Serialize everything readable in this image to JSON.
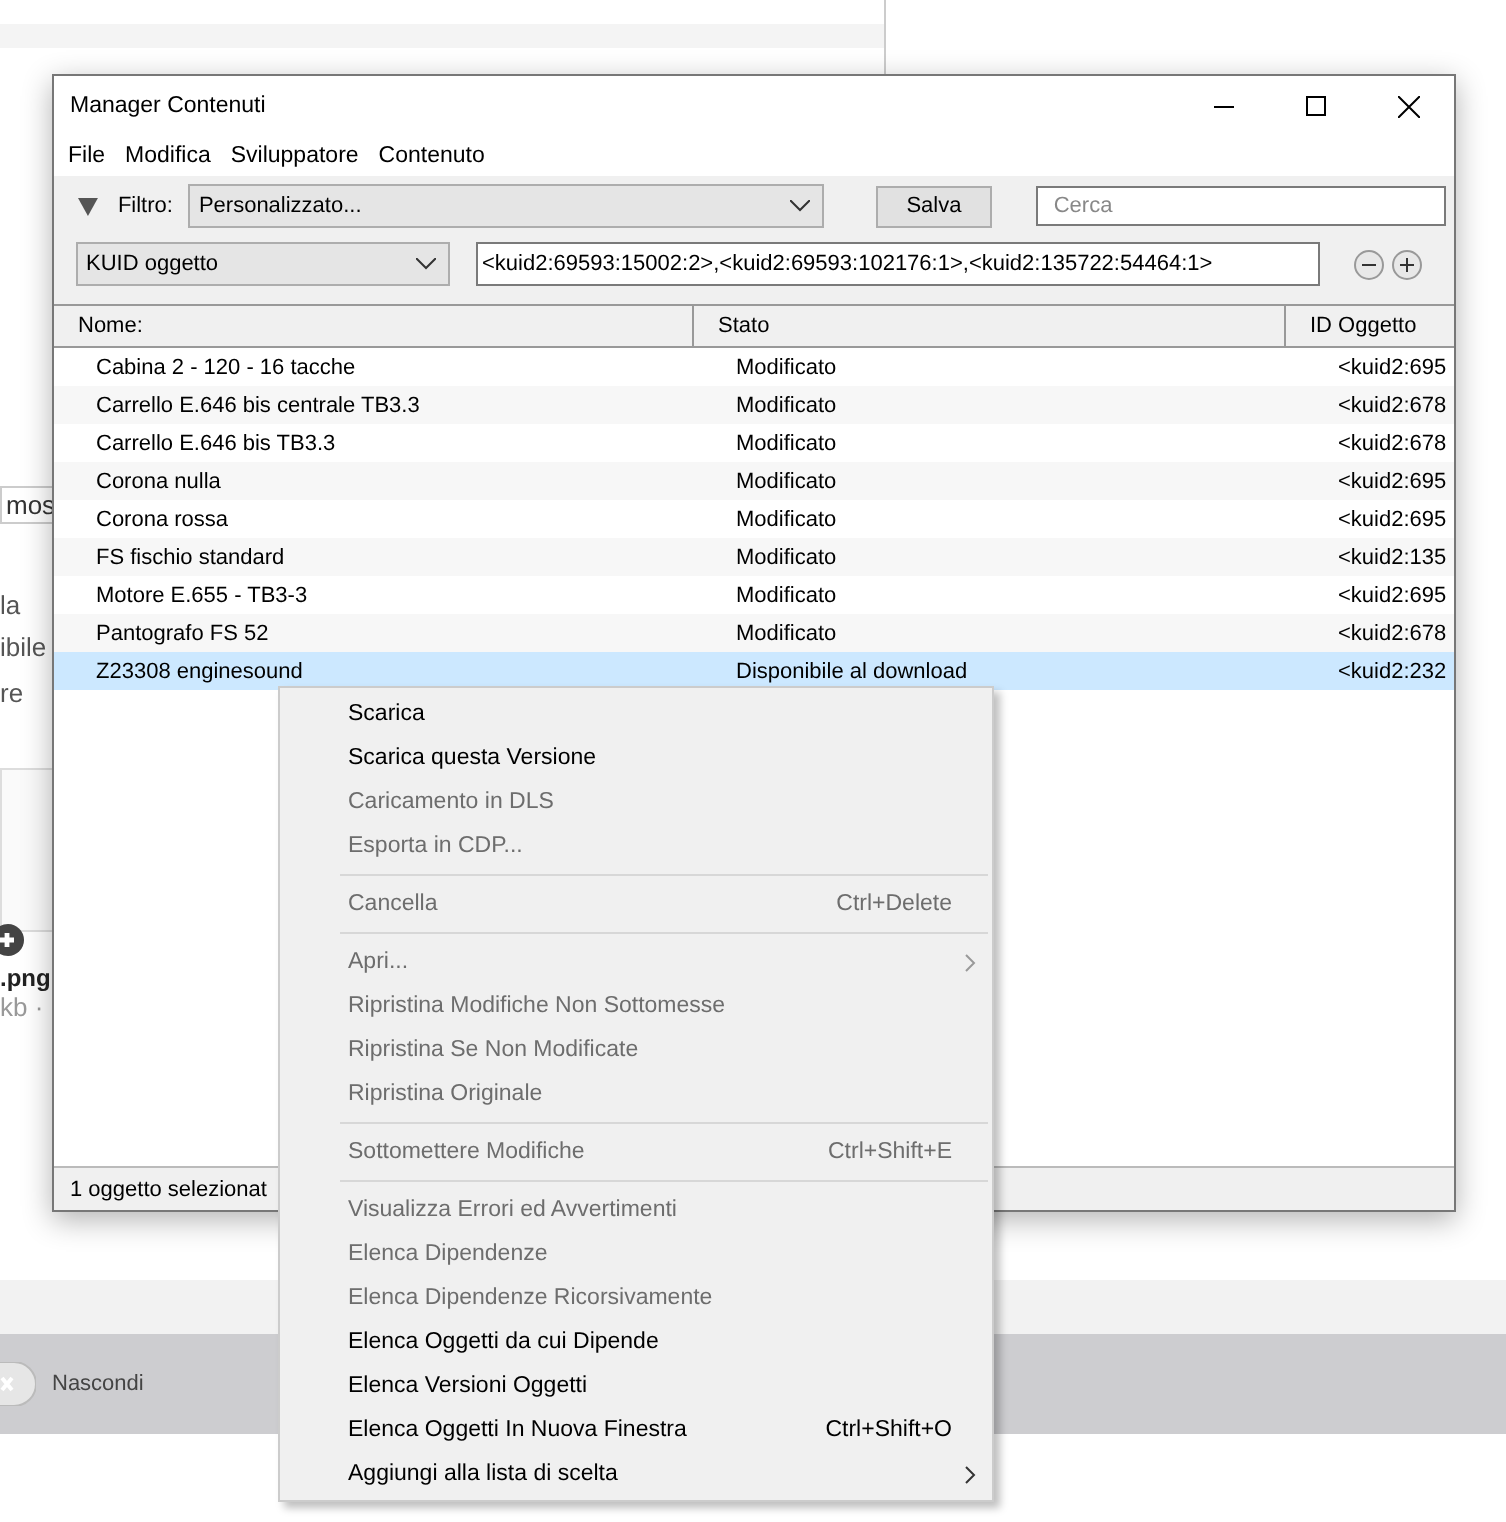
{
  "background": {
    "tab_fragment": "mos",
    "text_lines": [
      "la",
      "ibile"
    ],
    "link_prefix": "re",
    "file_name": ".png",
    "file_size": "kb ·",
    "hide_button": "Nascondi"
  },
  "window": {
    "title": "Manager Contenuti",
    "menu": [
      "File",
      "Modifica",
      "Sviluppatore",
      "Contenuto"
    ],
    "filter": {
      "label": "Filtro:",
      "value": "Personalizzato...",
      "save": "Salva",
      "search_placeholder": "Cerca"
    },
    "kuid": {
      "field": "KUID oggetto",
      "value": "<kuid2:69593:15002:2>,<kuid2:69593:102176:1>,<kuid2:135722:54464:1>"
    },
    "columns": [
      "Nome:",
      "Stato",
      "ID Oggetto"
    ],
    "rows": [
      {
        "name": "Cabina 2 - 120 - 16 tacche",
        "status": "Modificato",
        "id": "<kuid2:695",
        "selected": false
      },
      {
        "name": "Carrello E.646 bis centrale TB3.3",
        "status": "Modificato",
        "id": "<kuid2:678",
        "selected": false
      },
      {
        "name": "Carrello E.646 bis TB3.3",
        "status": "Modificato",
        "id": "<kuid2:678",
        "selected": false
      },
      {
        "name": "Corona nulla",
        "status": "Modificato",
        "id": "<kuid2:695",
        "selected": false
      },
      {
        "name": "Corona rossa",
        "status": "Modificato",
        "id": "<kuid2:695",
        "selected": false
      },
      {
        "name": "FS fischio standard",
        "status": "Modificato",
        "id": "<kuid2:135",
        "selected": false
      },
      {
        "name": "Motore E.655 - TB3-3",
        "status": "Modificato",
        "id": "<kuid2:695",
        "selected": false
      },
      {
        "name": "Pantografo FS 52",
        "status": "Modificato",
        "id": "<kuid2:678",
        "selected": false
      },
      {
        "name": "Z23308 enginesound",
        "status": "Disponibile al download",
        "id": "<kuid2:232",
        "selected": true
      }
    ],
    "status_bar": "1 oggetto selezionat"
  },
  "context_menu": [
    {
      "kind": "item",
      "label": "Scarica",
      "disabled": false
    },
    {
      "kind": "item",
      "label": "Scarica questa Versione",
      "disabled": false
    },
    {
      "kind": "item",
      "label": "Caricamento in DLS",
      "disabled": true
    },
    {
      "kind": "item",
      "label": "Esporta in CDP...",
      "disabled": true
    },
    {
      "kind": "separator"
    },
    {
      "kind": "item",
      "label": "Cancella",
      "disabled": true,
      "shortcut": "Ctrl+Delete"
    },
    {
      "kind": "separator"
    },
    {
      "kind": "item",
      "label": "Apri...",
      "disabled": true,
      "submenu": true
    },
    {
      "kind": "item",
      "label": "Ripristina Modifiche Non Sottomesse",
      "disabled": true
    },
    {
      "kind": "item",
      "label": "Ripristina Se Non Modificate",
      "disabled": true
    },
    {
      "kind": "item",
      "label": "Ripristina Originale",
      "disabled": true
    },
    {
      "kind": "separator"
    },
    {
      "kind": "item",
      "label": "Sottomettere Modifiche",
      "disabled": true,
      "shortcut": "Ctrl+Shift+E"
    },
    {
      "kind": "separator"
    },
    {
      "kind": "item",
      "label": "Visualizza Errori ed Avvertimenti",
      "disabled": true
    },
    {
      "kind": "item",
      "label": "Elenca Dipendenze",
      "disabled": true
    },
    {
      "kind": "item",
      "label": "Elenca Dipendenze Ricorsivamente",
      "disabled": true
    },
    {
      "kind": "item",
      "label": "Elenca Oggetti da cui Dipende",
      "disabled": false
    },
    {
      "kind": "item",
      "label": "Elenca Versioni Oggetti",
      "disabled": false
    },
    {
      "kind": "item",
      "label": "Elenca Oggetti In Nuova Finestra",
      "disabled": false,
      "shortcut": "Ctrl+Shift+O"
    },
    {
      "kind": "item",
      "label": "Aggiungi alla lista di scelta",
      "disabled": false,
      "submenu": true
    }
  ]
}
